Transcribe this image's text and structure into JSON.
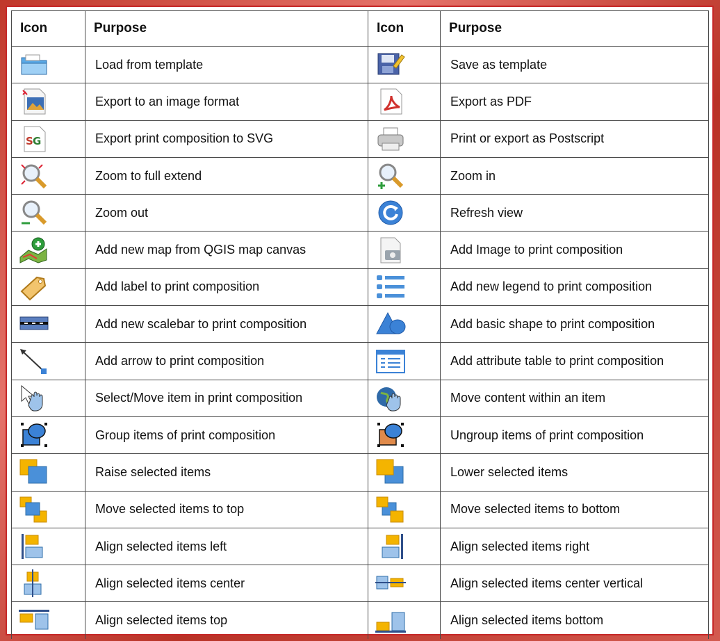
{
  "header": {
    "icon": "Icon",
    "purpose": "Purpose"
  },
  "rows": [
    {
      "left": {
        "icon": "folder-open-icon",
        "purpose": "Load from template"
      },
      "right": {
        "icon": "save-template-icon",
        "purpose": "Save as template"
      }
    },
    {
      "left": {
        "icon": "export-image-icon",
        "purpose": "Export to an image format"
      },
      "right": {
        "icon": "pdf-icon",
        "purpose": "Export as PDF"
      }
    },
    {
      "left": {
        "icon": "svg-icon",
        "purpose": "Export print composition to SVG"
      },
      "right": {
        "icon": "printer-icon",
        "purpose": "Print or export as Postscript"
      }
    },
    {
      "left": {
        "icon": "zoom-full-icon",
        "purpose": "Zoom to full extend"
      },
      "right": {
        "icon": "zoom-in-icon",
        "purpose": "Zoom in"
      }
    },
    {
      "left": {
        "icon": "zoom-out-icon",
        "purpose": "Zoom out"
      },
      "right": {
        "icon": "refresh-icon",
        "purpose": "Refresh view"
      }
    },
    {
      "left": {
        "icon": "add-map-icon",
        "purpose": "Add new map from QGIS map canvas"
      },
      "right": {
        "icon": "add-image-icon",
        "purpose": "Add Image to print composition"
      }
    },
    {
      "left": {
        "icon": "label-tag-icon",
        "purpose": "Add label to print composition"
      },
      "right": {
        "icon": "legend-icon",
        "purpose": "Add new legend to print composition"
      }
    },
    {
      "left": {
        "icon": "scalebar-icon",
        "purpose": "Add new scalebar to print composition"
      },
      "right": {
        "icon": "basic-shape-icon",
        "purpose": "Add basic shape to print composition"
      }
    },
    {
      "left": {
        "icon": "arrow-icon",
        "purpose": "Add arrow to print composition"
      },
      "right": {
        "icon": "attribute-table-icon",
        "purpose": "Add attribute table to print composition"
      }
    },
    {
      "left": {
        "icon": "select-move-icon",
        "purpose": "Select/Move item in print composition"
      },
      "right": {
        "icon": "move-content-icon",
        "purpose": "Move content within an item"
      }
    },
    {
      "left": {
        "icon": "group-icon",
        "purpose": "Group items of print composition"
      },
      "right": {
        "icon": "ungroup-icon",
        "purpose": "Ungroup items of print composition"
      }
    },
    {
      "left": {
        "icon": "raise-icon",
        "purpose": "Raise selected items"
      },
      "right": {
        "icon": "lower-icon",
        "purpose": "Lower selected items"
      }
    },
    {
      "left": {
        "icon": "move-top-icon",
        "purpose": "Move selected items to top"
      },
      "right": {
        "icon": "move-bottom-icon",
        "purpose": "Move selected items to bottom"
      }
    },
    {
      "left": {
        "icon": "align-left-icon",
        "purpose": "Align selected items left"
      },
      "right": {
        "icon": "align-right-icon",
        "purpose": "Align selected items right"
      }
    },
    {
      "left": {
        "icon": "align-center-icon",
        "purpose": "Align selected items center"
      },
      "right": {
        "icon": "align-center-vertical-icon",
        "purpose": "Align selected items center vertical"
      }
    },
    {
      "left": {
        "icon": "align-top-icon",
        "purpose": "Align selected items top"
      },
      "right": {
        "icon": "align-bottom-icon",
        "purpose": "Align selected items bottom"
      }
    }
  ]
}
